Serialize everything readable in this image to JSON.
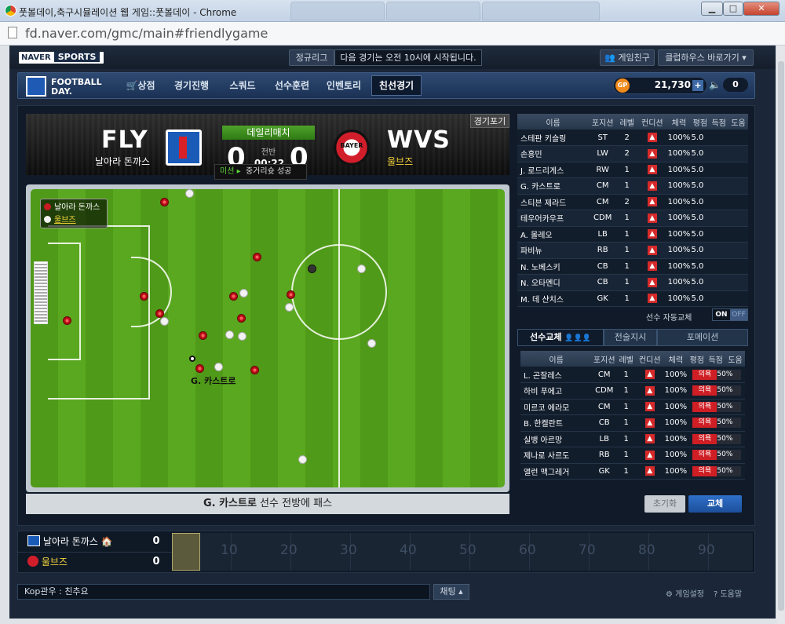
{
  "window": {
    "title": "풋볼데이,축구시뮬레이션 웹 게임::풋볼데이 - Chrome",
    "url": "fd.naver.com/gmc/main#friendlygame",
    "btn_min": "▁",
    "btn_max": "□",
    "btn_close": "✕"
  },
  "top": {
    "naver": "NAVER",
    "sports": "SPORTS",
    "league_tag": "정규리그",
    "notice": "다음 경기는 오전 10시에 시작됩니다.",
    "friends": "게임친구",
    "club": "클럽하우스 바로가기 ▾"
  },
  "nav": {
    "logo_line1": "FOOTBALL",
    "logo_line2": "DAY.",
    "items": [
      "상점",
      "경기진행",
      "스쿼드",
      "선수훈련",
      "인벤토리",
      "친선경기"
    ],
    "active": "친선경기",
    "gp_label": "GP",
    "gp_value": "21,730",
    "gp_plus": "+",
    "sound_value": "0"
  },
  "match": {
    "home_abbr": "FLY",
    "home_name": "날아라 돈까스",
    "away_abbr": "WVS",
    "away_name": "울브즈",
    "type": "데일리매치",
    "home_score": "0",
    "away_score": "0",
    "half": "전반",
    "clock": "00:22",
    "mission_label": "미션 ▸",
    "mission_text": "중거리슛 성공",
    "forfeit": "경기포기",
    "away_crest_text": "BAYER",
    "commentary_player": "G. 카스트로",
    "commentary_text": " 선수 전방에 패스",
    "ball_holder": "G. 카스트로"
  },
  "legend": {
    "home": "날아라 돈까스",
    "away": "울브즈"
  },
  "colors": {
    "home_dot": "#c81b22",
    "away_dot": "#f2f2f2",
    "accent_green": "#5fd33a",
    "away_name": "#f2d23a"
  },
  "lineup": {
    "headers": [
      "이름",
      "포지션",
      "레벨",
      "컨디션",
      "체력",
      "평점",
      "득점",
      "도움"
    ],
    "rows": [
      [
        "스테판 키슬링",
        "ST",
        "2",
        "100%",
        "5.0"
      ],
      [
        "손흥민",
        "LW",
        "2",
        "100%",
        "5.0"
      ],
      [
        "J. 로드리게스",
        "RW",
        "1",
        "100%",
        "5.0"
      ],
      [
        "G. 카스트로",
        "CM",
        "1",
        "100%",
        "5.0"
      ],
      [
        "스티븐 제라드",
        "CM",
        "2",
        "100%",
        "5.0"
      ],
      [
        "테우어카우프",
        "CDM",
        "1",
        "100%",
        "5.0"
      ],
      [
        "A. 몰레오",
        "LB",
        "1",
        "100%",
        "5.0"
      ],
      [
        "파비뉴",
        "RB",
        "1",
        "100%",
        "5.0"
      ],
      [
        "N. 노베스키",
        "CB",
        "1",
        "100%",
        "5.0"
      ],
      [
        "N. 오타멘디",
        "CB",
        "1",
        "100%",
        "5.0"
      ],
      [
        "M. 데 샨치스",
        "GK",
        "1",
        "100%",
        "5.0"
      ]
    ],
    "condition_icon": "▲"
  },
  "autosub": {
    "label": "선수 자동교체",
    "on": "ON",
    "off": "OFF"
  },
  "subtabs": [
    "선수교체",
    "전술지시",
    "포메이션"
  ],
  "subtab_icons": "👤👤👤",
  "bench": {
    "headers": [
      "이름",
      "포지션",
      "레벨",
      "컨디션",
      "체력",
      "평점",
      "득점",
      "도움"
    ],
    "rows": [
      [
        "L. 곤잘레스",
        "CM",
        "1",
        "100%",
        "의욕",
        "50%"
      ],
      [
        "하비 푸에고",
        "CDM",
        "1",
        "100%",
        "의욕",
        "50%"
      ],
      [
        "미르코 에라모",
        "CM",
        "1",
        "100%",
        "의욕",
        "50%"
      ],
      [
        "B. 한켈란트",
        "CB",
        "1",
        "100%",
        "의욕",
        "50%"
      ],
      [
        "실뱅 아르망",
        "LB",
        "1",
        "100%",
        "의욕",
        "50%"
      ],
      [
        "제나로 사르도",
        "RB",
        "1",
        "100%",
        "의욕",
        "50%"
      ],
      [
        "앨런 맥그레거",
        "GK",
        "1",
        "100%",
        "의욕",
        "50%"
      ]
    ],
    "reset": "초기화",
    "swap": "교체"
  },
  "timeline": {
    "home_name": "날아라 돈까스",
    "home_icon": "🏠",
    "away_name": "울브즈",
    "home_score": "0",
    "away_score": "0",
    "ticks": [
      "10",
      "20",
      "30",
      "40",
      "50",
      "60",
      "70",
      "80",
      "90"
    ],
    "progress": 0.022
  },
  "chat": {
    "input_value": "Kop관우 : 친추요",
    "button": "채팅 ▴",
    "settings": "⚙ 게임설정",
    "help": "? 도움말"
  }
}
